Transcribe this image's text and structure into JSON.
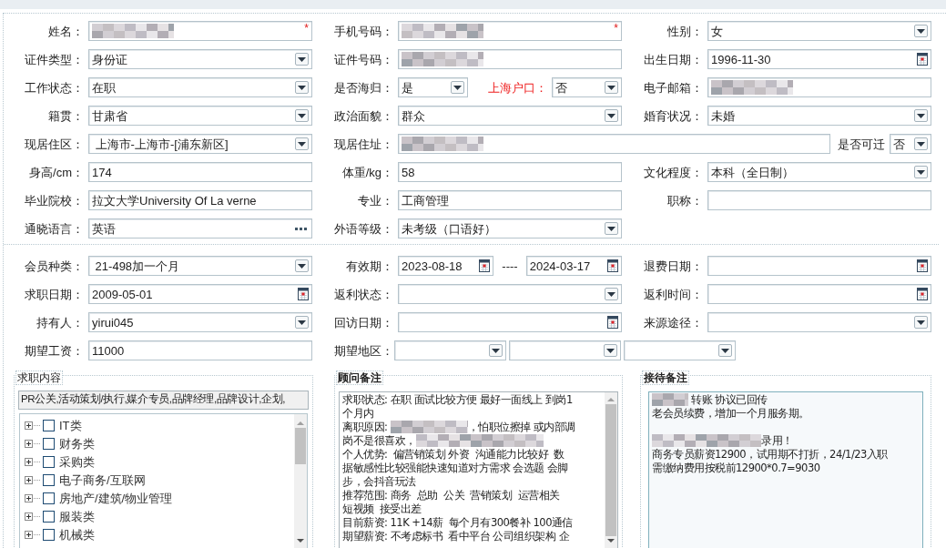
{
  "sections": [
    {
      "rows": [
        [
          {
            "items": [
              {
                "kind": "label",
                "text": "姓名："
              },
              {
                "kind": "text",
                "redacted": true,
                "required_mark": "*"
              }
            ]
          },
          {
            "items": [
              {
                "kind": "label",
                "text": "手机号码："
              },
              {
                "kind": "text",
                "redacted": true,
                "required_mark": "*"
              }
            ]
          },
          {
            "items": [
              {
                "kind": "label",
                "text": "性别："
              },
              {
                "kind": "select",
                "value": "女"
              }
            ]
          }
        ],
        [
          {
            "items": [
              {
                "kind": "label",
                "text": "证件类型："
              },
              {
                "kind": "select",
                "value": "身份证"
              }
            ]
          },
          {
            "items": [
              {
                "kind": "label",
                "text": "证件号码："
              },
              {
                "kind": "text",
                "redacted": true
              }
            ]
          },
          {
            "items": [
              {
                "kind": "label",
                "text": "出生日期："
              },
              {
                "kind": "date",
                "value": "1996-11-30"
              }
            ]
          }
        ],
        [
          {
            "items": [
              {
                "kind": "label",
                "text": "工作状态："
              },
              {
                "kind": "select",
                "value": "在职"
              }
            ]
          },
          {
            "items": [
              {
                "kind": "label",
                "text": "是否海归："
              },
              {
                "kind": "select",
                "value": "是"
              },
              {
                "kind": "label",
                "text": "上海户口：",
                "alert": true
              },
              {
                "kind": "select",
                "value": "否"
              }
            ]
          },
          {
            "items": [
              {
                "kind": "label",
                "text": "电子邮箱："
              },
              {
                "kind": "text",
                "redacted": true
              }
            ]
          }
        ],
        [
          {
            "items": [
              {
                "kind": "label",
                "text": "籍贯："
              },
              {
                "kind": "select",
                "value": "甘肃省"
              }
            ]
          },
          {
            "items": [
              {
                "kind": "label",
                "text": "政治面貌："
              },
              {
                "kind": "select",
                "value": "群众"
              }
            ]
          },
          {
            "items": [
              {
                "kind": "label",
                "text": "婚育状况："
              },
              {
                "kind": "select",
                "value": "未婚"
              }
            ]
          }
        ],
        [
          {
            "items": [
              {
                "kind": "label",
                "text": "现居住区："
              },
              {
                "kind": "select",
                "value": " 上海市-上海市-[浦东新区]"
              }
            ]
          },
          {
            "items": [
              {
                "kind": "label",
                "text": "现居住址："
              },
              {
                "kind": "text",
                "redacted": true
              },
              {
                "kind": "label",
                "text": "是否可迁"
              },
              {
                "kind": "select",
                "value": "否"
              }
            ]
          }
        ],
        [
          {
            "items": [
              {
                "kind": "label",
                "text": "身高/cm："
              },
              {
                "kind": "text",
                "value": "174"
              }
            ]
          },
          {
            "items": [
              {
                "kind": "label",
                "text": "体重/kg："
              },
              {
                "kind": "text",
                "value": "58"
              }
            ]
          },
          {
            "items": [
              {
                "kind": "label",
                "text": "文化程度："
              },
              {
                "kind": "select",
                "value": "本科（全日制）"
              }
            ]
          }
        ],
        [
          {
            "items": [
              {
                "kind": "label",
                "text": "毕业院校："
              },
              {
                "kind": "text",
                "value": "拉文大学University Of La verne"
              }
            ]
          },
          {
            "items": [
              {
                "kind": "label",
                "text": "专业："
              },
              {
                "kind": "text",
                "value": "工商管理"
              }
            ]
          },
          {
            "items": [
              {
                "kind": "label",
                "text": "职称："
              },
              {
                "kind": "text"
              }
            ]
          }
        ],
        [
          {
            "items": [
              {
                "kind": "label",
                "text": "通晓语言："
              },
              {
                "kind": "lookup",
                "value": "英语"
              }
            ]
          },
          {
            "items": [
              {
                "kind": "label",
                "text": "外语等级："
              },
              {
                "kind": "select",
                "value": "未考级（口语好）"
              }
            ]
          }
        ]
      ]
    },
    {
      "rows": [
        [
          {
            "items": [
              {
                "kind": "label",
                "text": "会员种类："
              },
              {
                "kind": "select",
                "value": " 21-498加一个月"
              }
            ]
          },
          {
            "items": [
              {
                "kind": "label",
                "text": "有效期："
              },
              {
                "kind": "date",
                "value": "2023-08-18"
              },
              {
                "kind": "dash",
                "text": "----"
              },
              {
                "kind": "date",
                "value": "2024-03-17"
              }
            ]
          },
          {
            "items": [
              {
                "kind": "label",
                "text": "退费日期："
              },
              {
                "kind": "date"
              }
            ]
          }
        ],
        [
          {
            "items": [
              {
                "kind": "label",
                "text": "求职日期："
              },
              {
                "kind": "date",
                "value": "2009-05-01"
              }
            ]
          },
          {
            "items": [
              {
                "kind": "label",
                "text": "返利状态："
              },
              {
                "kind": "select"
              }
            ]
          },
          {
            "items": [
              {
                "kind": "label",
                "text": "返利时间："
              },
              {
                "kind": "date"
              }
            ]
          }
        ],
        [
          {
            "items": [
              {
                "kind": "label",
                "text": "持有人："
              },
              {
                "kind": "select",
                "value": "yirui045"
              }
            ]
          },
          {
            "items": [
              {
                "kind": "label",
                "text": "回访日期："
              },
              {
                "kind": "date"
              }
            ]
          },
          {
            "items": [
              {
                "kind": "label",
                "text": "来源途径："
              },
              {
                "kind": "select"
              }
            ]
          }
        ],
        [
          {
            "items": [
              {
                "kind": "label",
                "text": "期望工资："
              },
              {
                "kind": "text",
                "value": "11000"
              }
            ]
          },
          {
            "items": [
              {
                "kind": "label",
                "text": "期望地区："
              },
              {
                "kind": "select"
              },
              {
                "kind": "select"
              },
              {
                "kind": "select"
              }
            ]
          }
        ]
      ]
    }
  ],
  "job_intent": {
    "legend": "求职内容",
    "summary": "PR公关,活动策划/执行,媒介专员,品牌经理,品牌设计,企划,",
    "categories": [
      {
        "label": "IT类",
        "checked": false,
        "expanded": false
      },
      {
        "label": "财务类",
        "checked": false,
        "expanded": false
      },
      {
        "label": "采购类",
        "checked": false,
        "expanded": false
      },
      {
        "label": "电子商务/互联网",
        "checked": false,
        "expanded": false
      },
      {
        "label": "房地产/建筑/物业管理",
        "checked": false,
        "expanded": false
      },
      {
        "label": "服装类",
        "checked": false,
        "expanded": false
      },
      {
        "label": "机械类",
        "checked": false,
        "expanded": false
      }
    ]
  },
  "advisor_notes": {
    "legend": "顾问备注",
    "lines": [
      [
        {
          "kind": "text",
          "text": "求职状态: 在职 面试比较方便 最好一面线上 到岗1"
        }
      ],
      [
        {
          "kind": "text",
          "text": "个月内"
        }
      ],
      [
        {
          "kind": "text",
          "text": "离职原因: "
        },
        {
          "kind": "redacted"
        },
        {
          "kind": "text",
          "text": "，怕职位擦掉 或内部调"
        }
      ],
      [
        {
          "kind": "text",
          "text": "岗不是很喜欢，"
        },
        {
          "kind": "redacted"
        }
      ],
      [
        {
          "kind": "text",
          "text": "个人优势:  偏营销策划 外资  沟通能力比较好  数"
        }
      ],
      [
        {
          "kind": "text",
          "text": "据敏感性比较强能快速知道对方需求 会选题 会脚"
        }
      ],
      [
        {
          "kind": "text",
          "text": "步，会抖音玩法"
        }
      ],
      [
        {
          "kind": "text",
          "text": "推荐范围: 商务  总助  公关  营销策划  运营相关"
        }
      ],
      [
        {
          "kind": "text",
          "text": "短视频  接受出差"
        }
      ],
      [
        {
          "kind": "text",
          "text": "目前薪资: 11K +14薪  每个月有300餐补 100通信"
        }
      ],
      [
        {
          "kind": "text",
          "text": "期望薪资: 不考虑标书  看中平台 公司组织架构 企"
        }
      ]
    ]
  },
  "reception_notes": {
    "legend": "接待备注",
    "lines": [
      [
        {
          "kind": "redacted"
        },
        {
          "kind": "text",
          "text": " 转账 协议已回传"
        }
      ],
      [
        {
          "kind": "text",
          "text": "老会员续费，增加一个月服务期。"
        }
      ],
      [
        {
          "kind": "blank"
        }
      ],
      [
        {
          "kind": "redacted"
        },
        {
          "kind": "text",
          "text": "录用！"
        }
      ],
      [
        {
          "kind": "text",
          "text": "商务专员薪资12900，试用期不打折，24/1/23入职"
        }
      ],
      [
        {
          "kind": "text",
          "text": "需缴纳费用按税前12900*0.7=9030"
        }
      ]
    ]
  }
}
